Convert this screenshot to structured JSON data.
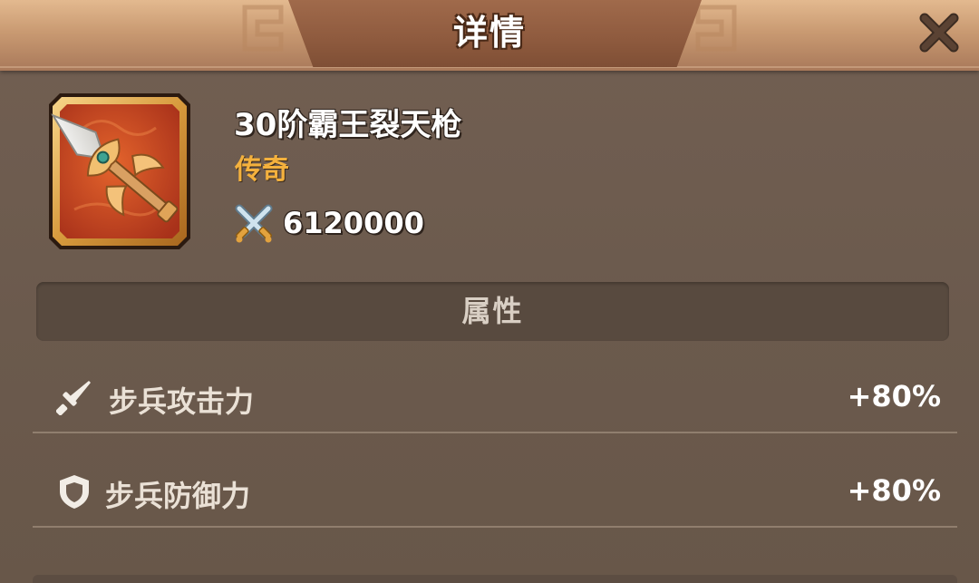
{
  "header": {
    "title": "详情"
  },
  "item": {
    "name": "30阶霸王裂天枪",
    "rarity": "传奇",
    "power": "6120000"
  },
  "section": {
    "title": "属性"
  },
  "attributes": [
    {
      "name": "步兵攻击力",
      "value": "+80%",
      "icon": "sword-icon"
    },
    {
      "name": "步兵防御力",
      "value": "+80%",
      "icon": "shield-icon"
    }
  ],
  "colors": {
    "rarity": "#f4b13d",
    "header": "#c99a72",
    "panel": "#6f5e51"
  }
}
